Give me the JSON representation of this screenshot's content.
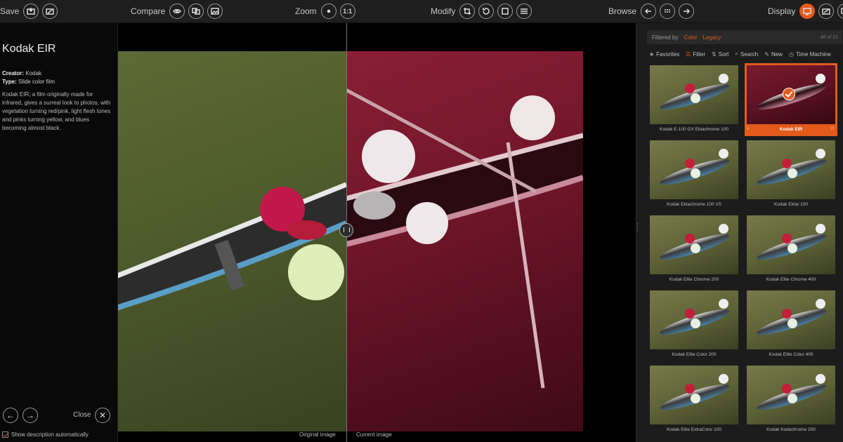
{
  "toolbar": {
    "save_label": "Save",
    "compare_label": "Compare",
    "zoom_label": "Zoom",
    "zoom_one_to_one": "1:1",
    "modify_label": "Modify",
    "browse_label": "Browse",
    "display_label": "Display",
    "accent_color": "#e25b1b"
  },
  "description": {
    "title": "Kodak EIR",
    "creator_label": "Creator:",
    "creator_value": "Kodak",
    "type_label": "Type:",
    "type_value": "Slide color film",
    "text": "Kodak EIR, a film originally made for infrared, gives a surreal look to photos, with vegetation turning red/pink, light flesh tones and pinks turning yellow, and blues becoming almost black.",
    "close_label": "Close",
    "show_auto_label": "Show description automatically"
  },
  "captions": {
    "original": "Original image",
    "current": "Current image"
  },
  "panel": {
    "filtered_by": "Filtered by",
    "filter_color": "Color",
    "filter_legacy": "Legacy",
    "count": "46 of 21",
    "tools": {
      "favorites": "Favorites",
      "filter": "Filter",
      "sort": "Sort",
      "search": "Search",
      "new": "New",
      "time_machine": "Time Machine"
    },
    "presets": [
      {
        "label": "Kodak E-100 GX Ektachrome 100",
        "selected": false
      },
      {
        "label": "Kodak EIR",
        "selected": true
      },
      {
        "label": "Kodak Ektachrome 100 VS",
        "selected": false
      },
      {
        "label": "Kodak Ektar 100",
        "selected": false
      },
      {
        "label": "Kodak Elite Chrome 200",
        "selected": false
      },
      {
        "label": "Kodak Elite Chrome 400",
        "selected": false
      },
      {
        "label": "Kodak Elite Color 200",
        "selected": false
      },
      {
        "label": "Kodak Elite Color 400",
        "selected": false
      },
      {
        "label": "Kodak Elite ExtraColor 100",
        "selected": false
      },
      {
        "label": "Kodak Kodachrome 200",
        "selected": false
      }
    ]
  }
}
